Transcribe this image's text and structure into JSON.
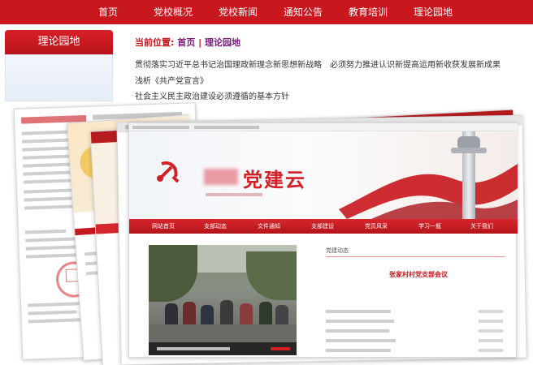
{
  "nav": {
    "items": [
      "首页",
      "党校概况",
      "党校新闻",
      "通知公告",
      "教育培训",
      "理论园地"
    ]
  },
  "sidebar": {
    "title": "理论园地"
  },
  "breadcrumb": {
    "prefix": "当前位置:",
    "home": "首页",
    "separator": "|",
    "current": "理论园地"
  },
  "articles": [
    "贯彻落实习近平总书记治国理政新理念新思想新战略　必须努力推进认识新提高运用新收获发展新成果",
    "浅析《共产党宣言》",
    "社会主义民主政治建设必须遵循的基本方针"
  ],
  "preview": {
    "site_title": "党建云",
    "nav_items": [
      "网站首页",
      "支部动态",
      "文件通知",
      "支部建设",
      "党员风采",
      "学习一瓶",
      "关于我们"
    ],
    "section_title": "党建动态",
    "headline": "张家村村党支部会议"
  },
  "colors": {
    "primary": "#c8171d",
    "breadcrumb_link": "#7a1a7a"
  }
}
